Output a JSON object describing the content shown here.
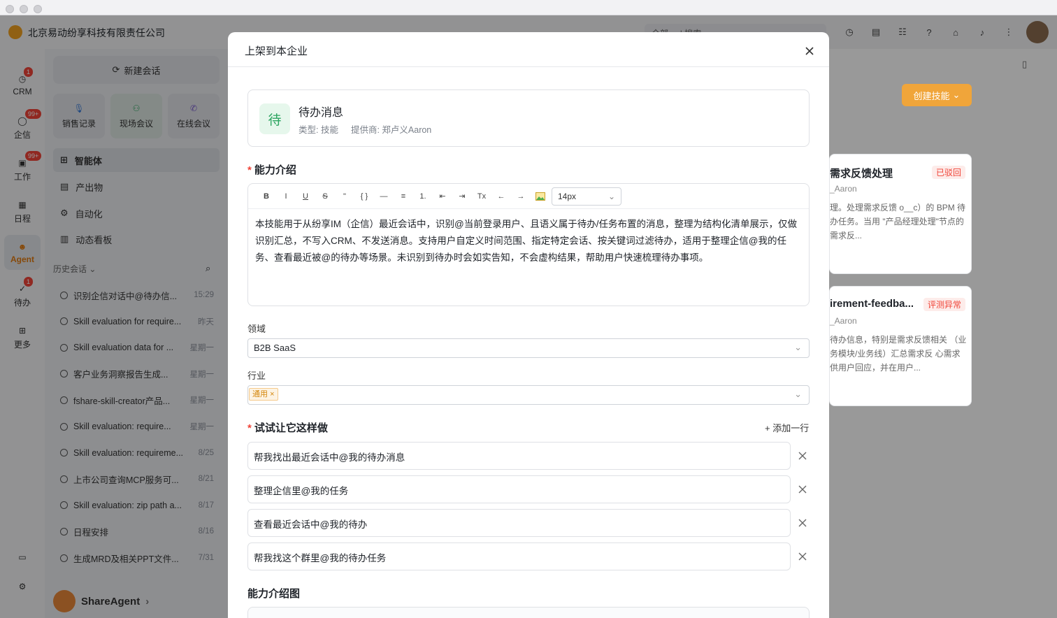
{
  "window": {
    "company": "北京易动纷享科技有限责任公司",
    "search_scope": "全部",
    "search_placeholder": "搜索"
  },
  "rail": [
    {
      "label": "CRM",
      "badge": "1",
      "icon": "clock-icon"
    },
    {
      "label": "企信",
      "badge": "99+",
      "icon": "chat-icon"
    },
    {
      "label": "工作",
      "badge": "99+",
      "icon": "work-icon"
    },
    {
      "label": "日程",
      "badge": "",
      "icon": "calendar-icon"
    },
    {
      "label": "Agent",
      "badge": "",
      "icon": "agent-icon"
    },
    {
      "label": "待办",
      "badge": "1",
      "icon": "todo-icon"
    },
    {
      "label": "更多",
      "badge": "",
      "icon": "grid-icon"
    }
  ],
  "sidebar": {
    "new_chat": "新建会话",
    "quick": [
      "销售记录",
      "现场会议",
      "在线会议"
    ],
    "nav": [
      "智能体",
      "产出物",
      "自动化",
      "动态看板"
    ],
    "history_header": "历史会话",
    "history": [
      {
        "title": "识别企信对话中@待办信...",
        "date": "15:29"
      },
      {
        "title": "Skill evaluation for require...",
        "date": "昨天"
      },
      {
        "title": "Skill evaluation data for ...",
        "date": "星期一"
      },
      {
        "title": "客户业务洞察报告生成...",
        "date": "星期一"
      },
      {
        "title": "fshare-skill-creator产品...",
        "date": "星期一"
      },
      {
        "title": "Skill evaluation: require...",
        "date": "星期一"
      },
      {
        "title": "Skill evaluation: requireme...",
        "date": "8/25"
      },
      {
        "title": "上市公司查询MCP服务可...",
        "date": "8/21"
      },
      {
        "title": "Skill evaluation: zip path a...",
        "date": "8/17"
      },
      {
        "title": "日程安排",
        "date": "8/16"
      },
      {
        "title": "生成MRD及相关PPT文件...",
        "date": "7/31"
      }
    ],
    "footer": "ShareAgent"
  },
  "background": {
    "create_skill": "创建技能",
    "cards": [
      {
        "title": "需求反馈处理",
        "status": "已驳回",
        "author": "_Aaron",
        "desc": "理。处理需求反馈 o__c）的 BPM 待办任务。当用 \"产品经理处理\"节点的需求反..."
      },
      {
        "title": "irement-feedba...",
        "status": "评测异常",
        "author": "_Aaron",
        "desc": "待办信息，特别是需求反馈相关 （业务模块/业务线）汇总需求反 心需求供用户回应，并在用户..."
      }
    ]
  },
  "modal": {
    "title": "上架到本企业",
    "skill": {
      "icon_char": "待",
      "name": "待办消息",
      "type": "类型: 技能",
      "provider": "提供商: 郑卢义Aaron"
    },
    "intro_label": "能力介绍",
    "toolbar": [
      "B",
      "I",
      "U",
      "S",
      "\"",
      "{ }",
      "—",
      "≡",
      "1.",
      "⇤",
      "⇥",
      "Tx",
      "←",
      "→"
    ],
    "font_size": "14px",
    "intro_text": "本技能用于从纷享IM（企信）最近会话中，识别@当前登录用户、且语义属于待办/任务布置的消息，整理为结构化清单展示，仅做识别汇总，不写入CRM、不发送消息。支持用户自定义时间范围、指定特定会话、按关键词过滤待办，适用于整理企信@我的任务、查看最近被@的待办等场景。未识别到待办时会如实告知，不会虚构结果，帮助用户快速梳理待办事项。",
    "domain_label": "领域",
    "domain_value": "B2B SaaS",
    "industry_label": "行业",
    "industry_tag": "通用",
    "prompts_label": "试试让它这样做",
    "add_row": "+ 添加一行",
    "prompts": [
      "帮我找出最近会话中@我的待办消息",
      "整理企信里@我的任务",
      "查看最近会话中@我的待办",
      "帮我找这个群里@我的待办任务"
    ],
    "image_label": "能力介绍图"
  },
  "colors": {
    "accent": "#f0a53a",
    "skill_green": "#2ca560",
    "required": "#f04438"
  }
}
